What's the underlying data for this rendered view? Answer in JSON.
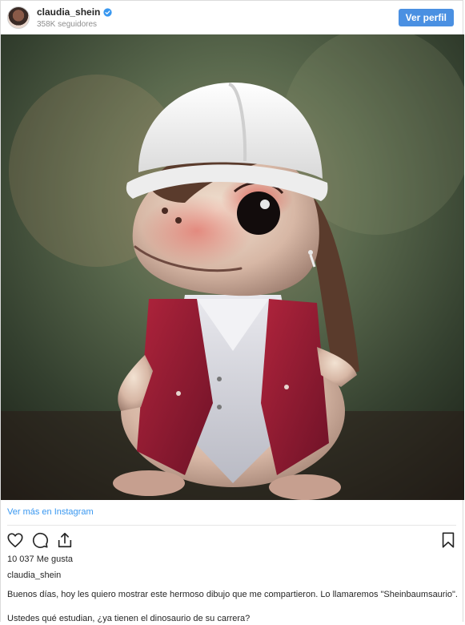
{
  "header": {
    "username": "claudia_shein",
    "followers": "358K seguidores",
    "view_profile": "Ver perfil"
  },
  "post": {
    "image_icon": "dinosaur-illustration",
    "view_more": "Ver más en Instagram",
    "likes": "10 037 Me gusta",
    "caption_user": "claudia_shein",
    "caption_line1": "Buenos días, hoy les quiero mostrar este hermoso dibujo que me compartieron. Lo llamaremos \"Sheinbaumsaurio\".",
    "caption_line2": "Ustedes qué estudian, ¿ya tienen el dinosaurio de su carrera?"
  },
  "icons": {
    "verified": "verified-badge-icon",
    "like": "heart-icon",
    "comment": "comment-icon",
    "share": "share-icon",
    "save": "bookmark-icon"
  },
  "colors": {
    "accent": "#4a90e2",
    "link": "#3897f0",
    "verified": "#3897f0"
  }
}
